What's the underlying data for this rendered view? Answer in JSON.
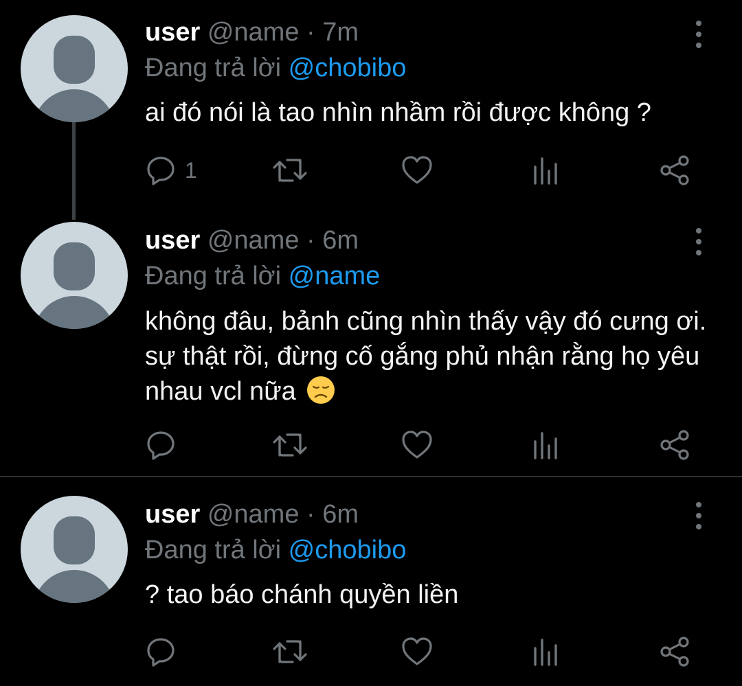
{
  "tweets": [
    {
      "user": "user",
      "handle": "@name",
      "separator": "·",
      "time": "7m",
      "reply_prefix": "Đang trả lời",
      "reply_to": "@chobibo",
      "text": "ai đó nói là tao nhìn nhầm rồi được không ?",
      "reply_count": "1"
    },
    {
      "user": "user",
      "handle": "@name",
      "separator": "·",
      "time": "6m",
      "reply_prefix": "Đang trả lời",
      "reply_to": "@name",
      "text": "không đâu, bảnh cũng nhìn thấy vậy đó cưng ơi. sự thật rồi, đừng cố gắng phủ nhận rằng họ yêu nhau vcl nữa",
      "emoji": "disappointed-face-emoji",
      "reply_count": ""
    },
    {
      "user": "user",
      "handle": "@name",
      "separator": "·",
      "time": "6m",
      "reply_prefix": "Đang trả lời",
      "reply_to": "@chobibo",
      "text": "? tao báo chánh quyền liền",
      "reply_count": ""
    }
  ],
  "icons": {
    "reply": "reply-icon",
    "retweet": "retweet-icon",
    "like": "heart-icon",
    "analytics": "analytics-icon",
    "share": "share-icon",
    "more": "more-options-icon"
  },
  "colors": {
    "background": "#000000",
    "text": "#f2f2f2",
    "muted": "#71767b",
    "mention": "#1d9bf0",
    "avatar_bg": "#ccd6dd",
    "avatar_fg": "#66757f"
  }
}
